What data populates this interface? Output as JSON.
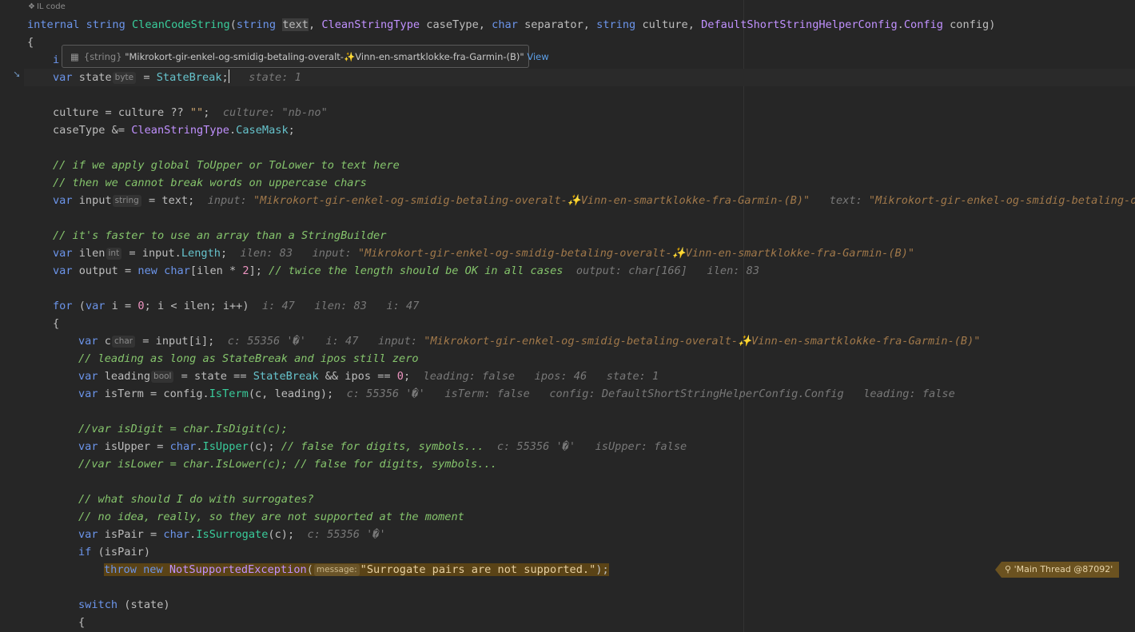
{
  "editor": {
    "il_code_label": "IL code",
    "tooltip": {
      "type": "{string}",
      "value": "\"Mikrokort-gir-enkel-og-smidig-betaling-overalt-✨Vinn-en-smartklokke-fra-Garmin-(B)\"",
      "view_link": "View"
    },
    "thread_badge": "'Main Thread @87092'",
    "signature": {
      "kw_internal": "internal",
      "kw_string": "string",
      "method": "CleanCodeString",
      "p1_type": "string",
      "p1_name": "text",
      "p2_type": "CleanStringType",
      "p2_name": "caseType",
      "p3_type": "char",
      "p3_name": "separator",
      "p4_type": "string",
      "p4_name": "culture",
      "p5_type_a": "DefaultShortStringHelperConfig",
      "p5_type_b": "Config",
      "p5_name": "config"
    },
    "hints": {
      "state": "state: 1",
      "culture": "culture: \"nb-no\"",
      "input1_label": "input: ",
      "input_value": "\"Mikrokort-gir-enkel-og-smidig-betaling-overalt-✨Vinn-en-smartklokke-fra-Garmin-(B)\"",
      "text_label": "text: ",
      "text_value": "\"Mikrokort-gir-enkel-og-smidig-betaling-over",
      "ilen": "ilen: 83",
      "input_label": "input: ",
      "output": "output: char[166]",
      "ilen2": "ilen: 83",
      "for_i": "i: 47",
      "for_ilen": "ilen: 83",
      "for_i2": "i: 47",
      "c": "c: 55356 '�'",
      "i": "i: 47",
      "leading": "leading: false",
      "ipos": "ipos: 46",
      "state2": "state: 1",
      "isterm_c": "c: 55356 '�'",
      "isterm": "isTerm: false",
      "config": "config: DefaultShortStringHelperConfig.Config",
      "isterm_leading": "leading: false",
      "isupper_c": "c: 55356 '�'",
      "isupper": "isUpper: false",
      "ispair_c": "c: 55356 '�'"
    },
    "inlays": {
      "byte": "byte",
      "string": "string",
      "int": "int",
      "char": "char",
      "bool": "bool",
      "message": "message:"
    },
    "code": {
      "l3_a": "var state",
      "l3_b": " = ",
      "l3_c": "StateBreak",
      "l3_d": ";",
      "l5": "culture = culture ?? ",
      "l5_str": "\"\"",
      "l5_end": ";",
      "l6_a": "caseType &= ",
      "l6_b": "CleanStringType",
      "l6_c": ".",
      "l6_d": "CaseMask",
      "l6_e": ";",
      "cm1": "// if we apply global ToUpper or ToLower to text here",
      "cm2": "// then we cannot break words on uppercase chars",
      "l10_a": "input",
      "l10_b": " = text;",
      "cm3": "// it's faster to use an array than a StringBuilder",
      "l13_a": "ilen",
      "l13_b": " = input.",
      "l13_c": "Length",
      "l13_d": ";",
      "l14_a": "output = ",
      "l14_b": "new",
      "l14_c": "char",
      "l14_d": "[ilen * ",
      "l14_e": "2",
      "l14_f": "]; ",
      "l14_cm": "// twice the length should be OK in all cases",
      "for_kw": "for",
      "for_a": " (",
      "for_var": "var",
      "for_b": " i = ",
      "for_0": "0",
      "for_c": "; i < ilen; i++)",
      "brace_open": "{",
      "c_a": "c",
      "c_b": " = input[i];",
      "cm4": "// leading as long as StateBreak and ipos still zero",
      "lead_a": "leading",
      "lead_b": " = state == ",
      "lead_c": "StateBreak",
      "lead_d": " && ipos == ",
      "lead_e": "0",
      "lead_f": ";",
      "term_a": "isTerm = config.",
      "term_b": "IsTerm",
      "term_c": "(c, leading);",
      "cm5": "//var isDigit = char.IsDigit(c);",
      "up_a": "isUpper = ",
      "up_b": "char",
      "up_c": ".",
      "up_d": "IsUpper",
      "up_e": "(c); ",
      "up_cm": "// false for digits, symbols...",
      "cm6": "//var isLower = char.IsLower(c); // false for digits, symbols...",
      "cm7": "// what should I do with surrogates?",
      "cm8": "// no idea, really, so they are not supported at the moment",
      "pair_a": "isPair = ",
      "pair_b": "char",
      "pair_c": ".",
      "pair_d": "IsSurrogate",
      "pair_e": "(c);",
      "if_kw": "if",
      "if_rest": " (isPair)",
      "throw_kw": "throw",
      "new_kw": "new",
      "exc": "NotSupportedException",
      "paren": "(",
      "msg": "\"Surrogate pairs are not supported.\"",
      "end": ");",
      "switch_kw": "switch",
      "switch_rest": " (state)",
      "var": "var",
      "brace_top": "{",
      "line2_start": "i"
    }
  }
}
